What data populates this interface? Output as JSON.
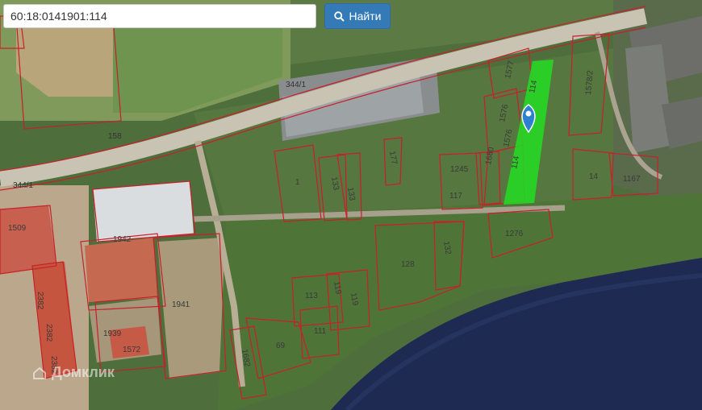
{
  "search": {
    "value": "60:18:0141901:114",
    "button_label": "Найти"
  },
  "watermark": "Домклик",
  "colors": {
    "parcel_border": "#c8202a",
    "selected_parcel": "#22dd22",
    "marker": "#2f7fd0",
    "search_button": "#337ab7"
  },
  "road_labels": [
    {
      "text": "344/1"
    },
    {
      "text": "158"
    },
    {
      "text": "344/1"
    }
  ],
  "parcels": [
    {
      "label": "1577"
    },
    {
      "label": "1576"
    },
    {
      "label": "1576"
    },
    {
      "label": "1578/2"
    },
    {
      "label": "114"
    },
    {
      "label": "114"
    },
    {
      "label": "1"
    },
    {
      "label": "133"
    },
    {
      "label": "133"
    },
    {
      "label": "177"
    },
    {
      "label": "1245"
    },
    {
      "label": "1680"
    },
    {
      "label": "117"
    },
    {
      "label": "14"
    },
    {
      "label": "1167"
    },
    {
      "label": "1509"
    },
    {
      "label": "1942"
    },
    {
      "label": "1276"
    },
    {
      "label": "132"
    },
    {
      "label": "128"
    },
    {
      "label": "113"
    },
    {
      "label": "119"
    },
    {
      "label": "119"
    },
    {
      "label": "1941"
    },
    {
      "label": "111"
    },
    {
      "label": "1939"
    },
    {
      "label": "1572"
    },
    {
      "label": "69"
    },
    {
      "label": "1682"
    },
    {
      "label": "2382"
    },
    {
      "label": "2382"
    },
    {
      "label": "2382"
    }
  ],
  "icons": {
    "search": "search-icon",
    "marker": "map-marker-icon"
  }
}
